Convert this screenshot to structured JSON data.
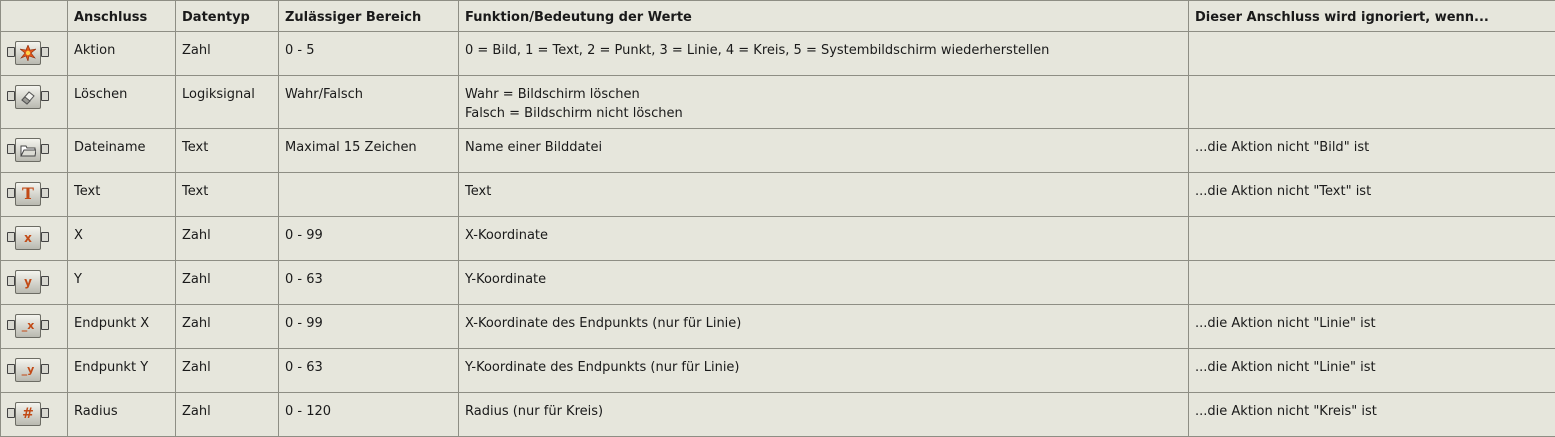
{
  "headers": {
    "icon": "",
    "anschluss": "Anschluss",
    "datentyp": "Datentyp",
    "bereich": "Zulässiger Bereich",
    "funktion": "Funktion/Bedeutung der Werte",
    "ignoriert": "Dieser Anschluss wird ignoriert, wenn..."
  },
  "rows": [
    {
      "icon": "star-burst-icon",
      "anschluss": "Aktion",
      "datentyp": "Zahl",
      "bereich": "0 - 5",
      "funktion": "0 = Bild, 1 = Text, 2 = Punkt, 3 = Linie, 4 = Kreis, 5 = Systembildschirm wiederherstellen",
      "funktion2": "",
      "ignoriert": ""
    },
    {
      "icon": "eraser-icon",
      "anschluss": "Löschen",
      "datentyp": "Logiksignal",
      "bereich": "Wahr/Falsch",
      "funktion": "Wahr = Bildschirm löschen",
      "funktion2": "Falsch = Bildschirm nicht löschen",
      "ignoriert": ""
    },
    {
      "icon": "folder-icon",
      "anschluss": "Dateiname",
      "datentyp": "Text",
      "bereich": "Maximal 15 Zeichen",
      "funktion": "Name einer Bilddatei",
      "funktion2": "",
      "ignoriert": "...die Aktion nicht \"Bild\" ist"
    },
    {
      "icon": "text-t-icon",
      "glyph": "T",
      "anschluss": "Text",
      "datentyp": "Text",
      "bereich": "",
      "funktion": "Text",
      "funktion2": "",
      "ignoriert": "...die Aktion nicht \"Text\" ist"
    },
    {
      "icon": "x-coordinate-icon",
      "glyph": "x",
      "anschluss": "X",
      "datentyp": "Zahl",
      "bereich": "0 - 99",
      "funktion": "X-Koordinate",
      "funktion2": "",
      "ignoriert": ""
    },
    {
      "icon": "y-coordinate-icon",
      "glyph": "y",
      "anschluss": "Y",
      "datentyp": "Zahl",
      "bereich": "0 - 63",
      "funktion": "Y-Koordinate",
      "funktion2": "",
      "ignoriert": ""
    },
    {
      "icon": "endpoint-x-icon",
      "glyph": "_x",
      "anschluss": "Endpunkt X",
      "datentyp": "Zahl",
      "bereich": "0 - 99",
      "funktion": "X-Koordinate des Endpunkts (nur für Linie)",
      "funktion2": "",
      "ignoriert": "...die Aktion nicht \"Linie\" ist"
    },
    {
      "icon": "endpoint-y-icon",
      "glyph": "_y",
      "anschluss": "Endpunkt Y",
      "datentyp": "Zahl",
      "bereich": "0 - 63",
      "funktion": "Y-Koordinate des Endpunkts (nur für Linie)",
      "funktion2": "",
      "ignoriert": "...die Aktion nicht \"Linie\" ist"
    },
    {
      "icon": "hash-radius-icon",
      "glyph": "#",
      "anschluss": "Radius",
      "datentyp": "Zahl",
      "bereich": "0 - 120",
      "funktion": "Radius (nur für Kreis)",
      "funktion2": "",
      "ignoriert": "...die Aktion nicht \"Kreis\" ist"
    }
  ],
  "colors": {
    "cell_background": "#e6e6dc",
    "border": "#8e8e84",
    "icon_accent": "#c24a16"
  }
}
